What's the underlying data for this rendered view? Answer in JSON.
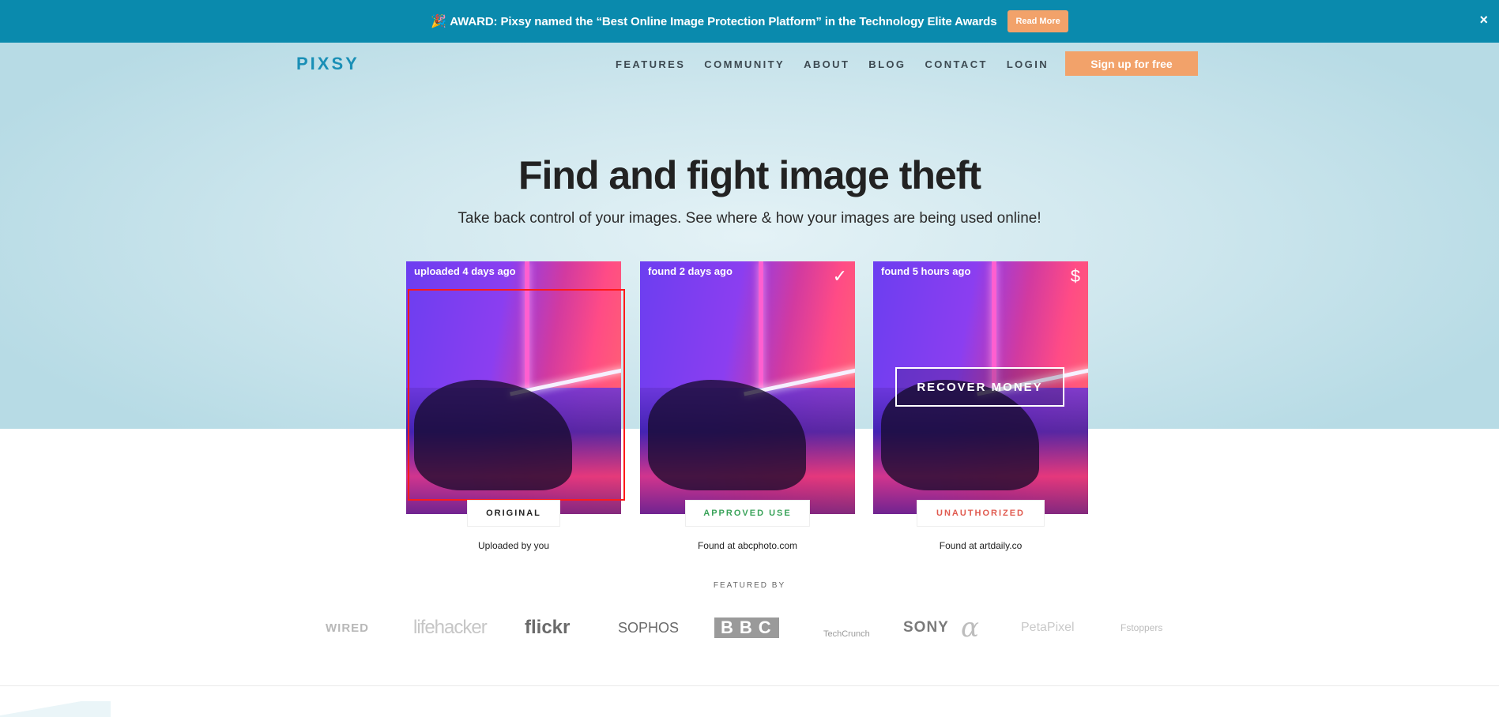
{
  "banner": {
    "text": "AWARD: Pixsy named the “Best Online Image Protection Platform” in the Technology Elite Awards",
    "button": "Read More",
    "close": "×",
    "icon": "trophy-icon"
  },
  "nav": {
    "logo": "PIXSY",
    "items": [
      "FEATURES",
      "COMMUNITY",
      "ABOUT",
      "BLOG",
      "CONTACT",
      "LOGIN"
    ],
    "signup": "Sign up for free"
  },
  "hero": {
    "title": "Find and fight image theft",
    "subtitle": "Take back control of your images. See where & how your images are being used online!"
  },
  "cards": [
    {
      "head": "uploaded 4 days ago",
      "badge": "ORIGINAL",
      "badge_color": "#222222",
      "caption": "Uploaded by you",
      "icon": ""
    },
    {
      "head": "found 2 days ago",
      "badge": "APPROVED USE",
      "badge_color": "#3aa35a",
      "caption": "Found at abcphoto.com",
      "icon": "✓"
    },
    {
      "head": "found 5 hours ago",
      "badge": "UNAUTHORIZED",
      "badge_color": "#e05a4f",
      "caption": "Found at artdaily.co",
      "icon": "$",
      "action": "RECOVER MONEY"
    }
  ],
  "featured": {
    "label": "FEATURED BY",
    "logos": [
      "WIRED",
      "lifehacker",
      "flickr",
      "SOPHOS",
      "BBC",
      "TechCrunch",
      "SONY",
      "PetaPixel",
      "Fstoppers"
    ]
  },
  "colors": {
    "banner": "#0a8aad",
    "accent": "#f2a26a",
    "logo": "#1a8fb6"
  }
}
